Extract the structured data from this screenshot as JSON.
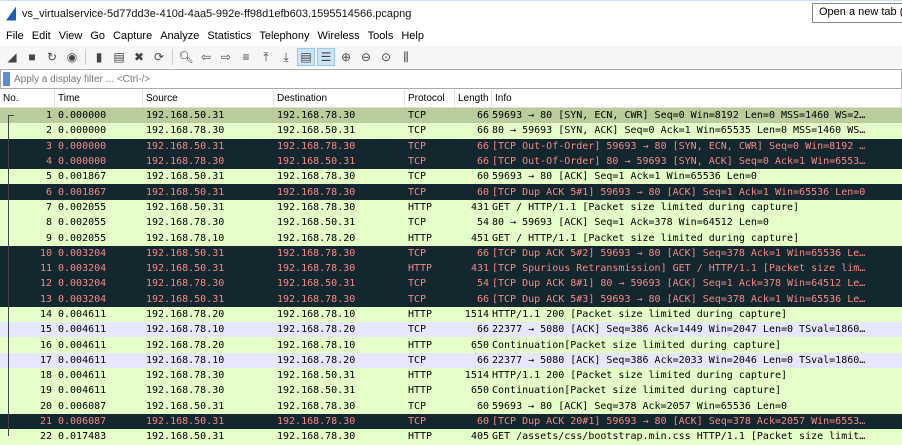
{
  "window": {
    "title": "vs_virtualservice-5d77dd3e-410d-4aa5-992e-ff98d1efb603.1595514566.pcapng",
    "new_tab": "Open a new tab (Ctrl+T)"
  },
  "menu": [
    "File",
    "Edit",
    "View",
    "Go",
    "Capture",
    "Analyze",
    "Statistics",
    "Telephony",
    "Wireless",
    "Tools",
    "Help"
  ],
  "toolbar": [
    "start-capture",
    "stop-capture",
    "restart-capture",
    "capture-options",
    "open-file",
    "save-file",
    "close-file",
    "reload-file",
    "find-packet",
    "go-back",
    "go-forward",
    "go-to-packet",
    "first-packet",
    "last-packet",
    "auto-scroll",
    "colorize",
    "zoom-in",
    "zoom-out",
    "normal-size",
    "resize-columns"
  ],
  "filter": {
    "placeholder": "Apply a display filter ... <Ctrl-/>"
  },
  "columns": [
    "No.",
    "Time",
    "Source",
    "Destination",
    "Protocol",
    "Length",
    "Info"
  ],
  "colors": {
    "normal": "#e4ffc7",
    "bad": "#12272e",
    "bad_text": "#f78787",
    "lavender": "#e7e6ff",
    "selected": "#b8cc9c"
  },
  "packets": [
    [
      "1",
      "0.000000",
      "192.168.50.31",
      "192.168.78.30",
      "TCP",
      "66",
      "59693 → 80 [SYN, ECN, CWR] Seq=0 Win=8192 Len=0 MSS=1460 WS=2…",
      "sel"
    ],
    [
      "2",
      "0.000000",
      "192.168.78.30",
      "192.168.50.31",
      "TCP",
      "66",
      "80 → 59693 [SYN, ACK] Seq=0 Ack=1 Win=65535 Len=0 MSS=1460 WS…",
      ""
    ],
    [
      "3",
      "0.000000",
      "192.168.50.31",
      "192.168.78.30",
      "TCP",
      "66",
      "[TCP Out-Of-Order] 59693 → 80 [SYN, ECN, CWR] Seq=0 Win=8192 …",
      "dark"
    ],
    [
      "4",
      "0.000000",
      "192.168.78.30",
      "192.168.50.31",
      "TCP",
      "66",
      "[TCP Out-Of-Order] 80 → 59693 [SYN, ACK] Seq=0 Ack=1 Win=6553…",
      "dark"
    ],
    [
      "5",
      "0.001867",
      "192.168.50.31",
      "192.168.78.30",
      "TCP",
      "60",
      "59693 → 80 [ACK] Seq=1 Ack=1 Win=65536 Len=0",
      ""
    ],
    [
      "6",
      "0.001867",
      "192.168.50.31",
      "192.168.78.30",
      "TCP",
      "60",
      "[TCP Dup ACK 5#1] 59693 → 80 [ACK] Seq=1 Ack=1 Win=65536 Len=0",
      "dark"
    ],
    [
      "7",
      "0.002055",
      "192.168.50.31",
      "192.168.78.30",
      "HTTP",
      "431",
      "GET / HTTP/1.1 [Packet size limited during capture]",
      ""
    ],
    [
      "8",
      "0.002055",
      "192.168.78.30",
      "192.168.50.31",
      "TCP",
      "54",
      "80 → 59693 [ACK] Seq=1 Ack=378 Win=64512 Len=0",
      ""
    ],
    [
      "9",
      "0.002055",
      "192.168.78.10",
      "192.168.78.20",
      "HTTP",
      "451",
      "GET / HTTP/1.1 [Packet size limited during capture]",
      ""
    ],
    [
      "10",
      "0.003204",
      "192.168.50.31",
      "192.168.78.30",
      "TCP",
      "66",
      "[TCP Dup ACK 5#2] 59693 → 80 [ACK] Seq=378 Ack=1 Win=65536 Le…",
      "dark"
    ],
    [
      "11",
      "0.003204",
      "192.168.50.31",
      "192.168.78.30",
      "HTTP",
      "431",
      "[TCP Spurious Retransmission] GET / HTTP/1.1 [Packet size lim…",
      "dark"
    ],
    [
      "12",
      "0.003204",
      "192.168.78.30",
      "192.168.50.31",
      "TCP",
      "54",
      "[TCP Dup ACK 8#1] 80 → 59693 [ACK] Seq=1 Ack=378 Win=64512 Le…",
      "dark"
    ],
    [
      "13",
      "0.003204",
      "192.168.50.31",
      "192.168.78.30",
      "TCP",
      "66",
      "[TCP Dup ACK 5#3] 59693 → 80 [ACK] Seq=378 Ack=1 Win=65536 Le…",
      "dark"
    ],
    [
      "14",
      "0.004611",
      "192.168.78.20",
      "192.168.78.10",
      "HTTP",
      "1514",
      "HTTP/1.1 200  [Packet size limited during capture]",
      ""
    ],
    [
      "15",
      "0.004611",
      "192.168.78.10",
      "192.168.78.20",
      "TCP",
      "66",
      "22377 → 5080 [ACK] Seq=386 Ack=1449 Win=2047 Len=0 TSval=1860…",
      "lav"
    ],
    [
      "16",
      "0.004611",
      "192.168.78.20",
      "192.168.78.10",
      "HTTP",
      "650",
      "Continuation[Packet size limited during capture]",
      ""
    ],
    [
      "17",
      "0.004611",
      "192.168.78.10",
      "192.168.78.20",
      "TCP",
      "66",
      "22377 → 5080 [ACK] Seq=386 Ack=2033 Win=2046 Len=0 TSval=1860…",
      "lav"
    ],
    [
      "18",
      "0.004611",
      "192.168.78.30",
      "192.168.50.31",
      "HTTP",
      "1514",
      "HTTP/1.1 200  [Packet size limited during capture]",
      ""
    ],
    [
      "19",
      "0.004611",
      "192.168.78.30",
      "192.168.50.31",
      "HTTP",
      "650",
      "Continuation[Packet size limited during capture]",
      ""
    ],
    [
      "20",
      "0.006087",
      "192.168.50.31",
      "192.168.78.30",
      "TCP",
      "60",
      "59693 → 80 [ACK] Seq=378 Ack=2057 Win=65536 Len=0",
      ""
    ],
    [
      "21",
      "0.006087",
      "192.168.50.31",
      "192.168.78.30",
      "TCP",
      "60",
      "[TCP Dup ACK 20#1] 59693 → 80 [ACK] Seq=378 Ack=2057 Win=6553…",
      "dark"
    ],
    [
      "22",
      "0.017483",
      "192.168.50.31",
      "192.168.78.30",
      "HTTP",
      "405",
      "GET /assets/css/bootstrap.min.css HTTP/1.1 [Packet size limit…",
      ""
    ]
  ]
}
